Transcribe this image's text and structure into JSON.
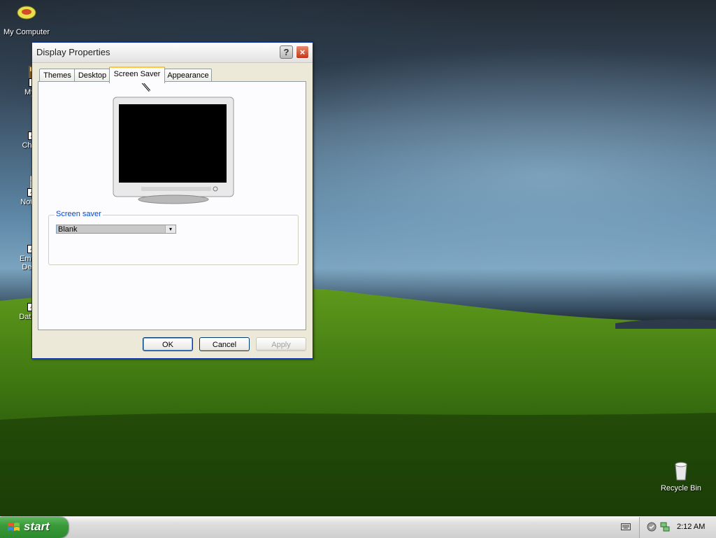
{
  "desktop": {
    "icons": [
      {
        "label": "My Computer"
      },
      {
        "label": "MyPa"
      },
      {
        "label": "Chrom"
      },
      {
        "label": "Notepa"
      },
      {
        "label": "Embarc",
        "label2": "Dev-C"
      },
      {
        "label": "DataWa"
      },
      {
        "label": "Recycle Bin"
      }
    ]
  },
  "window": {
    "title": "Display Properties",
    "help_label": "?",
    "close_label": "×",
    "tabs": [
      {
        "label": "Themes"
      },
      {
        "label": "Desktop"
      },
      {
        "label": "Screen Saver"
      },
      {
        "label": "Appearance"
      }
    ],
    "active_tab": "Screen Saver",
    "screen_saver": {
      "group_label": "Screen saver",
      "selected": "Blank"
    },
    "buttons": {
      "ok": "OK",
      "cancel": "Cancel",
      "apply": "Apply"
    }
  },
  "taskbar": {
    "start_label": "start",
    "clock": "2:12 AM"
  }
}
